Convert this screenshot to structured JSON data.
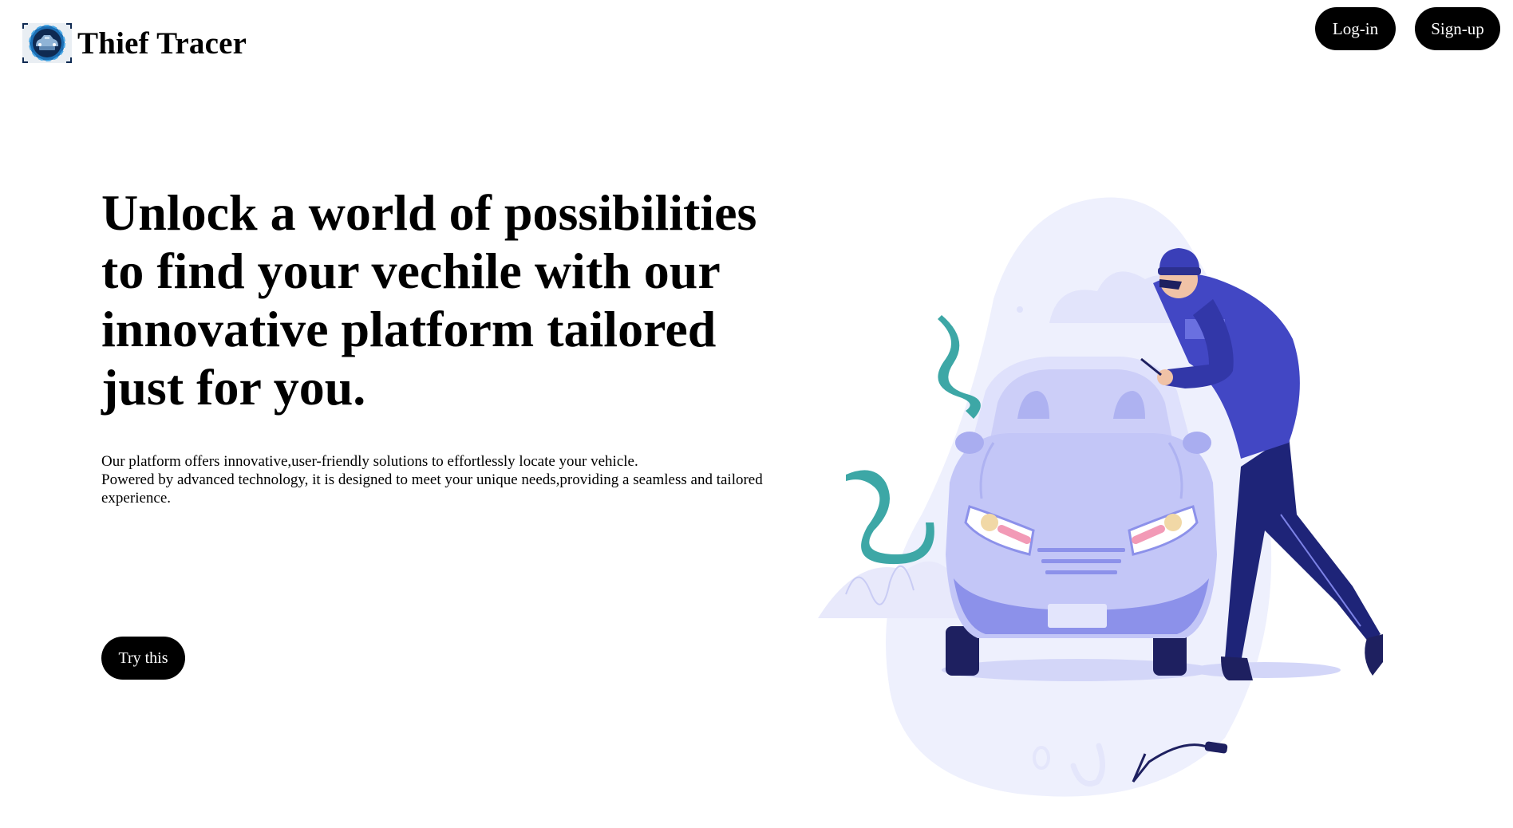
{
  "header": {
    "brand": "Thief Tracer",
    "logo_icon": "car-target-logo-icon",
    "login_label": "Log-in",
    "signup_label": "Sign-up"
  },
  "hero": {
    "title_lines": [
      "Unlock a world of possibilities",
      "to find your vechile with our",
      "innovative platform tailored",
      "just for you."
    ],
    "description_lines": [
      "Our platform offers innovative,user-friendly solutions to effortlessly locate your vehicle.",
      "Powered by advanced technology, it is designed to meet your unique needs,providing a seamless and tailored",
      "experience."
    ],
    "cta_label": "Try this"
  },
  "illustration": {
    "subject": "car-thief-illustration",
    "colors": {
      "blob": "#eef0fd",
      "car_body": "#c3c6f7",
      "car_dark": "#8c91ea",
      "thief_dark": "#1e2478",
      "thief_mid": "#4247c4",
      "smoke": "#3da7a6"
    }
  }
}
